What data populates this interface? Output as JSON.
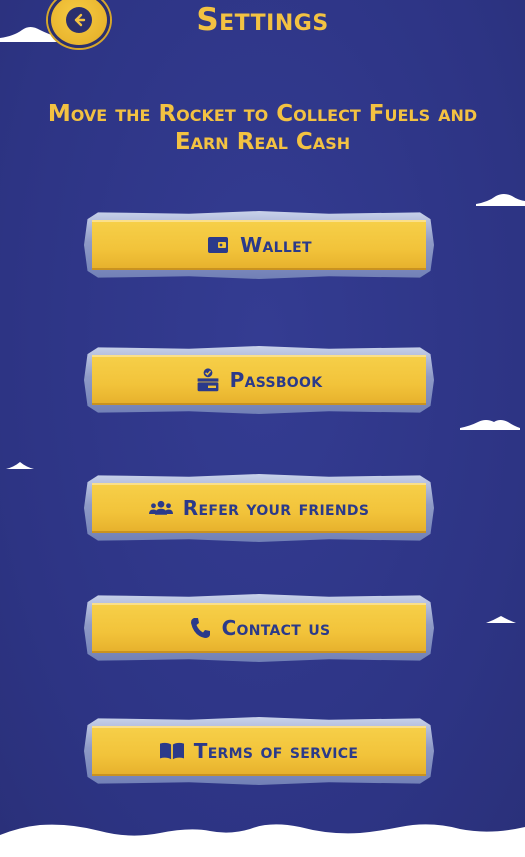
{
  "header": {
    "title": "Settings",
    "back_icon": "arrow-left-icon"
  },
  "tagline": "Move the Rocket to Collect Fuels and Earn Real Cash",
  "menu": [
    {
      "label": "Wallet",
      "icon": "wallet-icon"
    },
    {
      "label": "Passbook",
      "icon": "passbook-icon"
    },
    {
      "label": "Refer your friends",
      "icon": "users-icon"
    },
    {
      "label": "Contact us",
      "icon": "phone-icon"
    },
    {
      "label": "Terms of service",
      "icon": "book-icon"
    }
  ],
  "colors": {
    "background": "#2f3688",
    "accent_yellow": "#f3c242",
    "button_text": "#2b3a8a",
    "button_frame": "#8f9bc7"
  }
}
